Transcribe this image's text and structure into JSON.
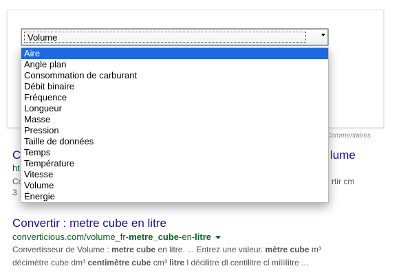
{
  "converter": {
    "select_value": "Volume",
    "options": [
      "Aire",
      "Angle plan",
      "Consommation de carburant",
      "Débit binaire",
      "Fréquence",
      "Longueur",
      "Masse",
      "Pression",
      "Taille de données",
      "Temps",
      "Température",
      "Vitesse",
      "Volume",
      "Énergie"
    ],
    "highlighted_option": "Aire",
    "comments_label": "Commentaires"
  },
  "result1": {
    "title_left": "C",
    "title_right": "lume",
    "url_left": "ht",
    "snippet_line1_left": "Co",
    "snippet_line1_right": "rtir cm",
    "snippet_line2_left": "3"
  },
  "result2": {
    "title": "Convertir : metre cube en litre",
    "url_parts": [
      {
        "text": "converticious.com/volume_fr-",
        "bold": false
      },
      {
        "text": "metre_cube",
        "bold": true
      },
      {
        "text": "-en-",
        "bold": false
      },
      {
        "text": "litre",
        "bold": true
      }
    ],
    "snippet_line1": [
      {
        "text": "Convertisseur de Volume : ",
        "bold": false
      },
      {
        "text": "metre cube",
        "bold": true
      },
      {
        "text": " en litre. ... Entrez une valeur. ",
        "bold": false
      },
      {
        "text": "mètre cube",
        "bold": true
      },
      {
        "text": " m³",
        "bold": false
      }
    ],
    "snippet_line2": [
      {
        "text": "décimètre cube dm³ ",
        "bold": false
      },
      {
        "text": "centimètre cube",
        "bold": true
      },
      {
        "text": " cm³ ",
        "bold": false
      },
      {
        "text": "litre",
        "bold": true
      },
      {
        "text": " l décilitre dl centilitre cl millilitre ...",
        "bold": false
      }
    ]
  }
}
